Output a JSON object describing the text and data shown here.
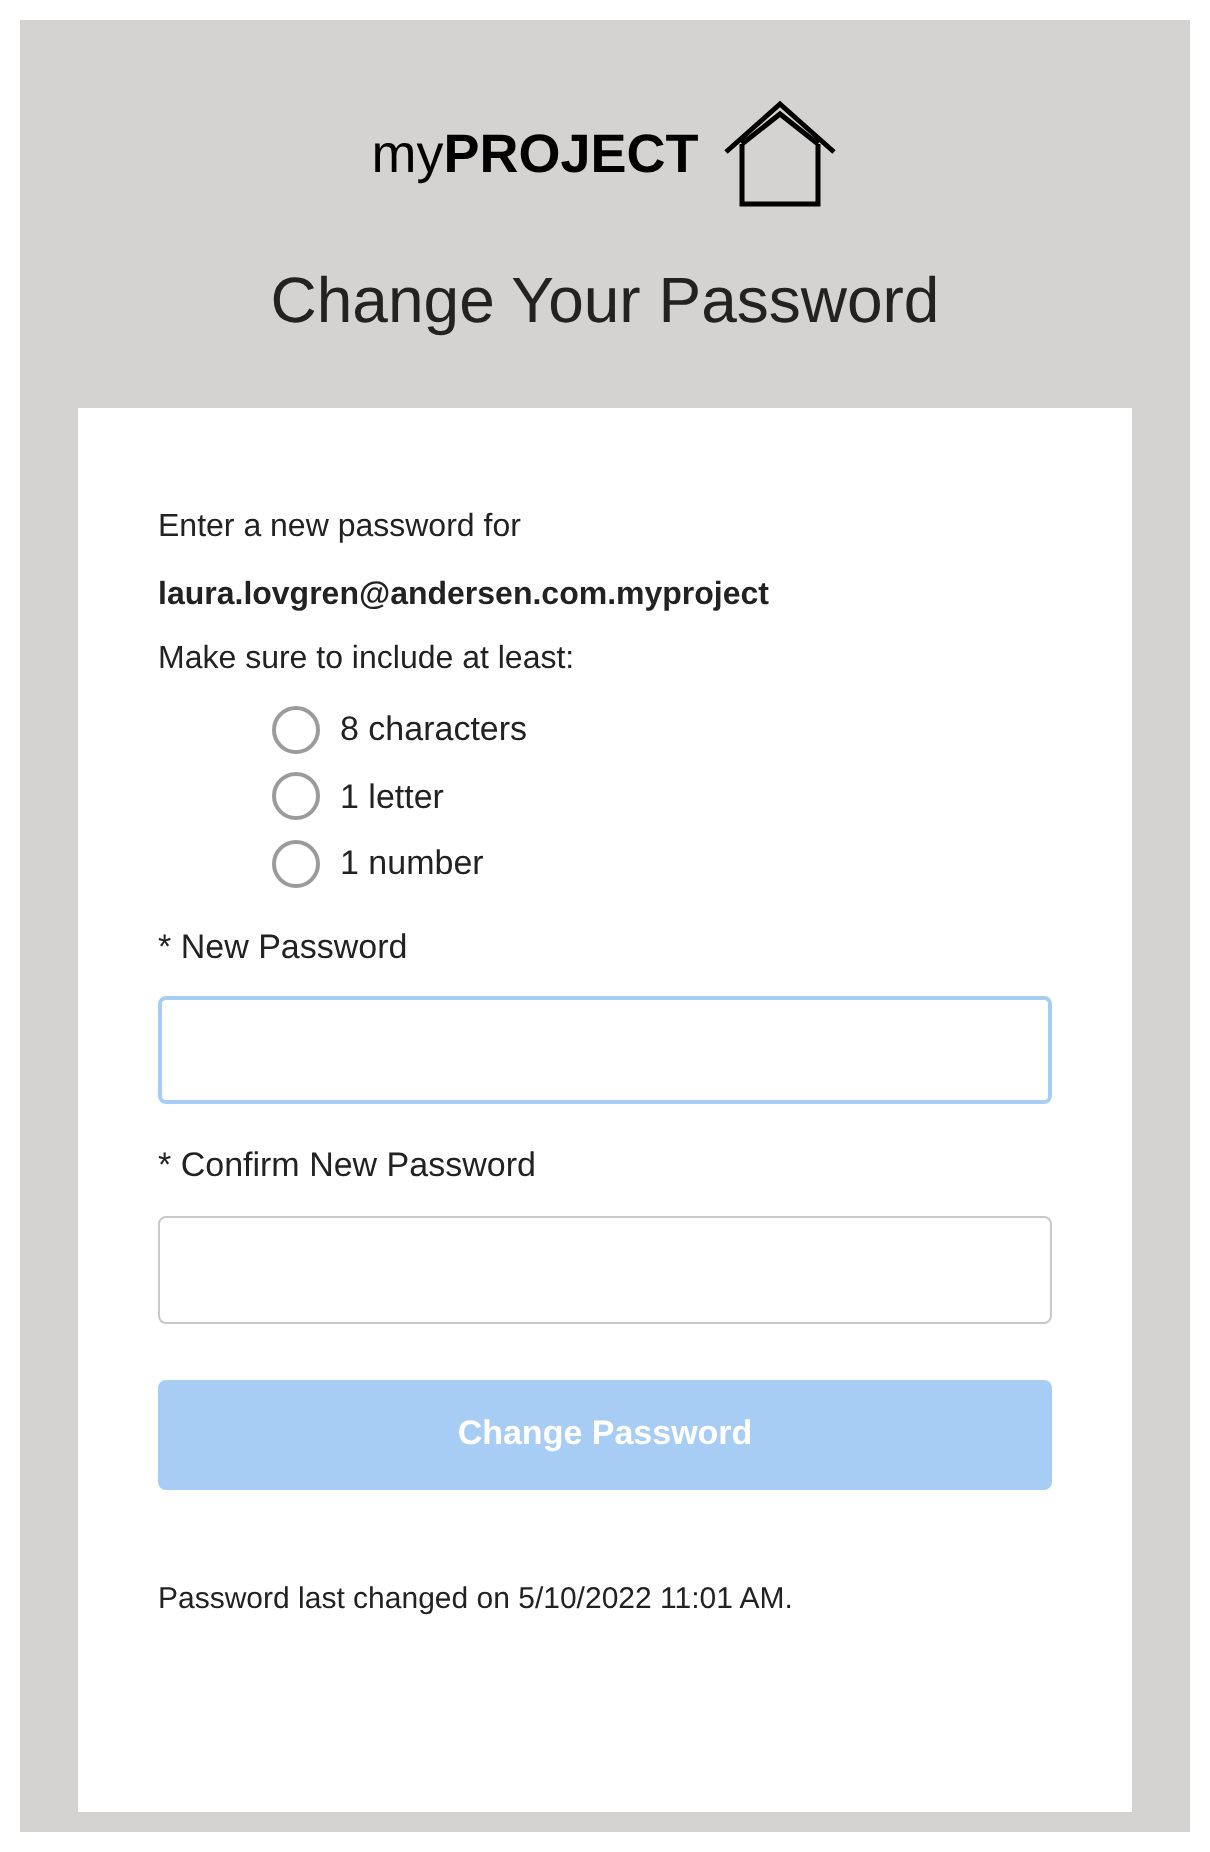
{
  "logo": {
    "text": "my**PROJECT**"
  },
  "title": "Change Your Password",
  "intro": "Enter a new password for",
  "username": "laura.lovgren@andersen.com.myproject",
  "requirements_intro": "Make sure to include at least:",
  "requirements": [
    {
      "label": "8 characters",
      "met": false
    },
    {
      "label": "1 letter",
      "met": false
    },
    {
      "label": "1 number",
      "met": false
    }
  ],
  "fields": [
    {
      "label": "* New Password",
      "focused": true
    },
    {
      "label": "* Confirm New Password",
      "focused": false
    }
  ],
  "submit": {
    "label": "Change Password",
    "disabled": true
  },
  "footer": "Password last changed on 5/10/2022 11:01 AM."
}
